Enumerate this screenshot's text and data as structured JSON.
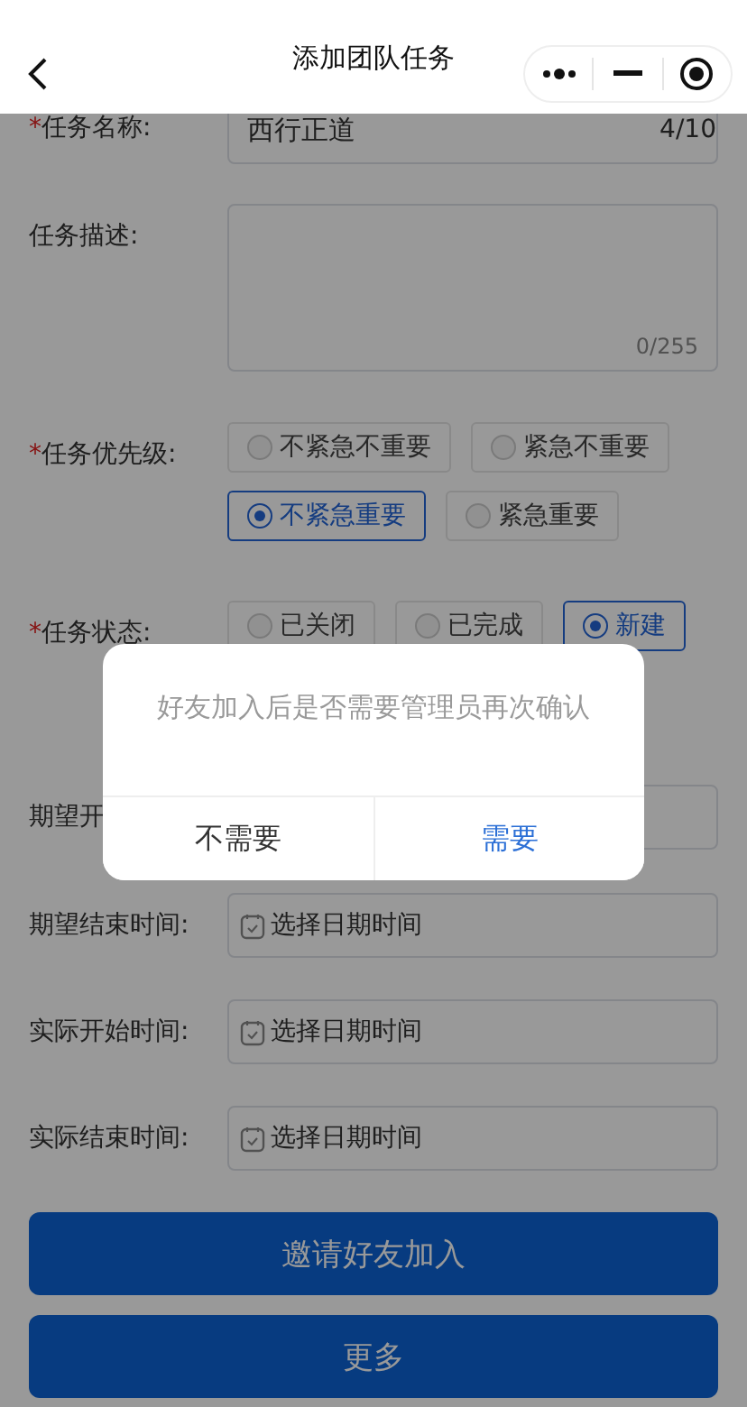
{
  "header": {
    "title": "添加团队任务"
  },
  "fields": [
    {
      "kind": "text",
      "mark": "*",
      "label": "任务名称:",
      "value": "西行正道",
      "counter": "4/10"
    },
    {
      "kind": "textarea",
      "label": "任务描述:",
      "counter": "0/255"
    },
    {
      "kind": "radio",
      "mark": "*",
      "label": "任务优先级:",
      "options": [
        {
          "label": "不紧急不重要",
          "selected": false
        },
        {
          "label": "紧急不重要",
          "selected": false
        },
        {
          "label": "不紧急重要",
          "selected": true
        },
        {
          "label": "紧急重要",
          "selected": false
        }
      ]
    },
    {
      "kind": "radio",
      "mark": "*",
      "label": "任务状态:",
      "options": [
        {
          "label": "已关闭",
          "selected": false
        },
        {
          "label": "已完成",
          "selected": false
        },
        {
          "label": "新建",
          "selected": true
        }
      ]
    },
    {
      "kind": "date",
      "label": "期望开"
    },
    {
      "kind": "date",
      "label": "期望结束时间:",
      "placeholder": "选择日期时间"
    },
    {
      "kind": "date",
      "label": "实际开始时间:",
      "placeholder": "选择日期时间"
    },
    {
      "kind": "date",
      "label": "实际结束时间:",
      "placeholder": "选择日期时间"
    }
  ],
  "buttons": [
    "邀请好友加入",
    "更多"
  ],
  "dialog": {
    "message": "好友加入后是否需要管理员再次确认",
    "buttons": [
      {
        "label": "不需要",
        "primary": false
      },
      {
        "label": "需要",
        "primary": true
      }
    ]
  }
}
